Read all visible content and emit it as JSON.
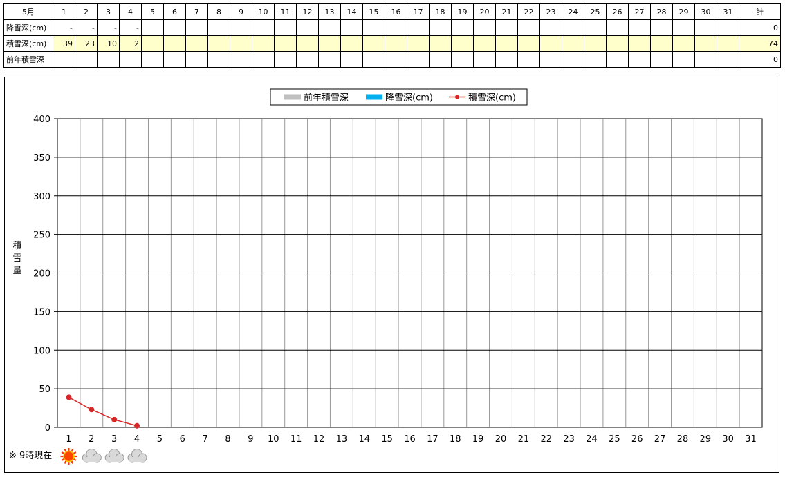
{
  "table": {
    "month_label": "5月",
    "days": [
      "1",
      "2",
      "3",
      "4",
      "5",
      "6",
      "7",
      "8",
      "9",
      "10",
      "11",
      "12",
      "13",
      "14",
      "15",
      "16",
      "17",
      "18",
      "19",
      "20",
      "21",
      "22",
      "23",
      "24",
      "25",
      "26",
      "27",
      "28",
      "29",
      "30",
      "31"
    ],
    "total_label": "計",
    "rows": [
      {
        "label": "降雪深(cm)",
        "values": [
          "-",
          "-",
          "-",
          "-",
          "",
          "",
          "",
          "",
          "",
          "",
          "",
          "",
          "",
          "",
          "",
          "",
          "",
          "",
          "",
          "",
          "",
          "",
          "",
          "",
          "",
          "",
          "",
          "",
          "",
          "",
          ""
        ],
        "total": "0",
        "highlight": false
      },
      {
        "label": "積雪深(cm)",
        "values": [
          "39",
          "23",
          "10",
          "2",
          "",
          "",
          "",
          "",
          "",
          "",
          "",
          "",
          "",
          "",
          "",
          "",
          "",
          "",
          "",
          "",
          "",
          "",
          "",
          "",
          "",
          "",
          "",
          "",
          "",
          "",
          ""
        ],
        "total": "74",
        "highlight": true
      },
      {
        "label": "前年積雪深",
        "values": [
          "",
          "",
          "",
          "",
          "",
          "",
          "",
          "",
          "",
          "",
          "",
          "",
          "",
          "",
          "",
          "",
          "",
          "",
          "",
          "",
          "",
          "",
          "",
          "",
          "",
          "",
          "",
          "",
          "",
          "",
          ""
        ],
        "total": "0",
        "highlight": false
      }
    ]
  },
  "chart_data": {
    "type": "line",
    "x": [
      1,
      2,
      3,
      4,
      5,
      6,
      7,
      8,
      9,
      10,
      11,
      12,
      13,
      14,
      15,
      16,
      17,
      18,
      19,
      20,
      21,
      22,
      23,
      24,
      25,
      26,
      27,
      28,
      29,
      30,
      31
    ],
    "series": [
      {
        "name": "前年積雪深",
        "kind": "bar",
        "color": "#bfbfbf",
        "values": []
      },
      {
        "name": "降雪深(cm)",
        "kind": "bar",
        "color": "#00b0f0",
        "values": []
      },
      {
        "name": "積雪深(cm)",
        "kind": "line",
        "color": "#d62728",
        "values": [
          39,
          23,
          10,
          2
        ]
      }
    ],
    "ylabel": "積雪量",
    "ylim": [
      0,
      400
    ],
    "yticks": [
      0,
      50,
      100,
      150,
      200,
      250,
      300,
      350,
      400
    ],
    "grid": true,
    "legend": "top-center"
  },
  "footer": {
    "note": "※ 9時現在",
    "weather_icons": [
      "sun-icon",
      "cloud-icon",
      "cloud-icon",
      "cloud-icon"
    ]
  }
}
